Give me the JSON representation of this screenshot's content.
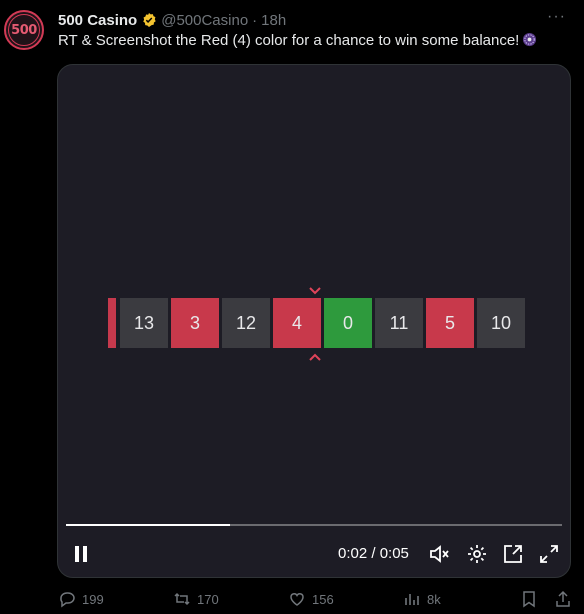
{
  "author": {
    "avatar_text": "500",
    "name": "500 Casino",
    "handle": "@500Casino",
    "separator": "·",
    "time": "18h",
    "more": "···"
  },
  "tweet": {
    "text": "RT & Screenshot the Red (4) color for a chance to win some balance!",
    "emoji": "roulette-wheel-emoji"
  },
  "video": {
    "roulette": [
      {
        "label": "13",
        "color": "gray"
      },
      {
        "label": "3",
        "color": "red"
      },
      {
        "label": "12",
        "color": "gray"
      },
      {
        "label": "4",
        "color": "red"
      },
      {
        "label": "0",
        "color": "green"
      },
      {
        "label": "11",
        "color": "gray"
      },
      {
        "label": "5",
        "color": "red"
      },
      {
        "label": "10",
        "color": "gray"
      }
    ],
    "progress_fraction": 0.33,
    "timecode": "0:02 / 0:05"
  },
  "actions": {
    "replies": "199",
    "retweets": "170",
    "likes": "156",
    "views": "8k"
  },
  "colors": {
    "red": "#c8394b",
    "green": "#2e9a3d",
    "gray": "#3b3b40",
    "verified": "#f4c430",
    "brand": "#d23a55"
  }
}
